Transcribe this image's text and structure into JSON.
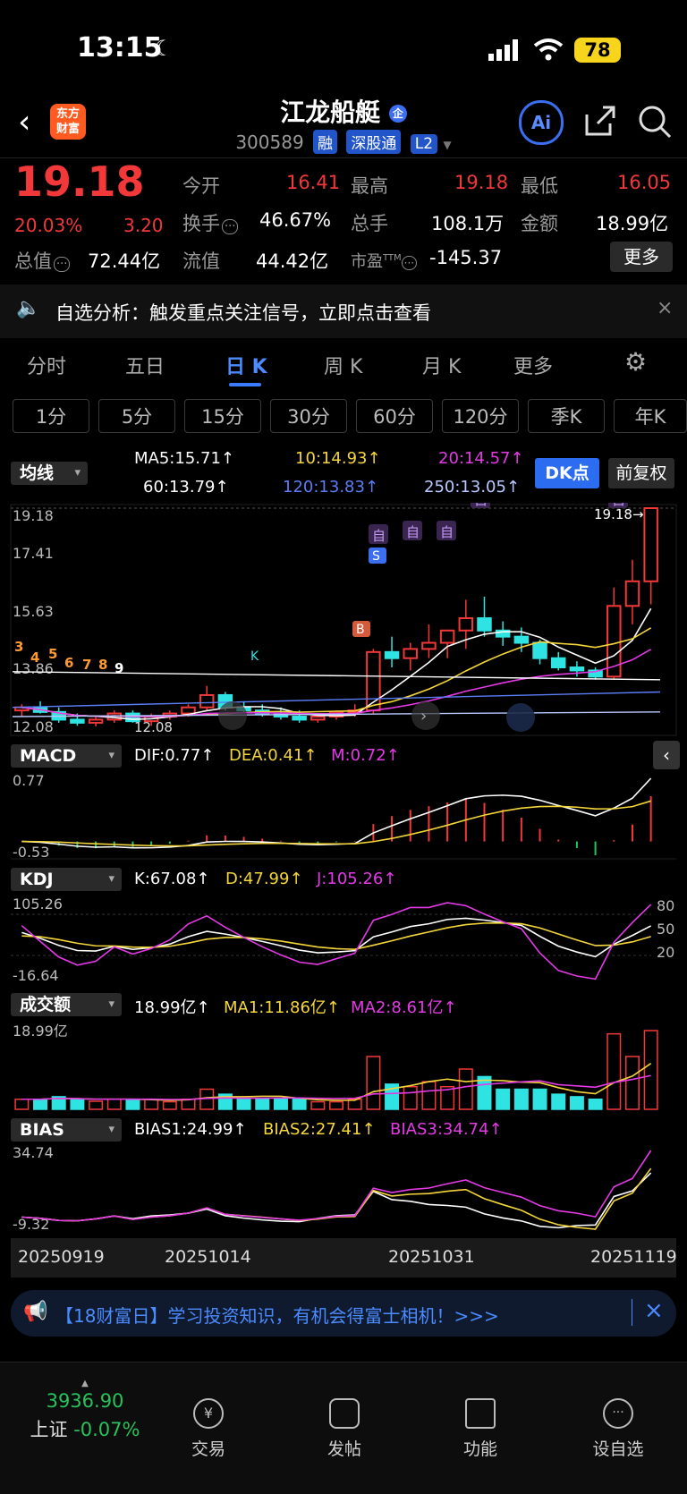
{
  "status_bar": {
    "time": "13:15",
    "battery": "78"
  },
  "header": {
    "logo_text_1": "东方",
    "logo_text_2": "财富",
    "stock_name": "江龙船艇",
    "code": "300589",
    "tags": [
      "融",
      "深股通",
      "L2"
    ]
  },
  "quote": {
    "price": "19.18",
    "change_pct": "20.03%",
    "change": "3.20",
    "today_open_label": "今开",
    "today_open": "16.41",
    "high_label": "最高",
    "high": "19.18",
    "low_label": "最低",
    "low": "16.05",
    "turnover_label": "换手",
    "turnover": "46.67%",
    "volume_label": "总手",
    "volume": "108.1万",
    "amount_label": "金额",
    "amount": "18.99亿",
    "mktcap_label": "总值",
    "mktcap": "72.44亿",
    "float_label": "流值",
    "float_cap": "44.42亿",
    "pe_label": "市盈",
    "pe_sup": "TTM",
    "pe": "-145.37",
    "more_button": "更多"
  },
  "notice": {
    "text": "自选分析：触发重点关注信号，立即点击查看"
  },
  "period_tabs": [
    "分时",
    "五日",
    "日 K",
    "周 K",
    "月 K",
    "更多"
  ],
  "active_tab": "日 K",
  "minute_buttons": [
    "1分",
    "5分",
    "15分",
    "30分",
    "60分",
    "120分",
    "季K",
    "年K"
  ],
  "ma": {
    "label": "均线",
    "ma5": "MA5:15.71↑",
    "ma10": "10:14.93↑",
    "ma20": "20:14.57↑",
    "ma60": "60:13.79↑",
    "ma120": "120:13.83↑",
    "ma250": "250:13.05↑",
    "dk_button": "DK点",
    "fuquan_button": "前复权"
  },
  "colors": {
    "red": "#f23838",
    "cyan": "#2fe3e3",
    "white": "#ffffff",
    "yellow": "#f4d63a",
    "magenta": "#e43ae6",
    "blue": "#5b7df6"
  },
  "kline_axis": {
    "y_top": "19.18",
    "y2": "17.41",
    "y3": "15.63",
    "y4": "13.86",
    "y_bottom": "12.08",
    "last_label": "19.18→",
    "low_label": "12.08",
    "marker_self": "自",
    "marker_s": "S",
    "marker_b": "B",
    "marker_k": "K",
    "seq": [
      "3",
      "4",
      "5",
      "6",
      "7",
      "8",
      "9"
    ]
  },
  "macd": {
    "label": "MACD",
    "dif": "DIF:0.77↑",
    "dea": "DEA:0.41↑",
    "m": "M:0.72↑",
    "y_top": "0.77",
    "y_bottom": "-0.53"
  },
  "kdj": {
    "label": "KDJ",
    "k": "K:67.08↑",
    "d": "D:47.99↑",
    "j": "J:105.26↑",
    "y_top": "105.26",
    "y_bottom": "-16.64",
    "r80": "80",
    "r50": "50",
    "r20": "20"
  },
  "volume": {
    "label": "成交额",
    "v": "18.99亿↑",
    "ma1": "MA1:11.86亿↑",
    "ma2": "MA2:8.61亿↑",
    "y_top": "18.99亿"
  },
  "bias": {
    "label": "BIAS",
    "b1": "BIAS1:24.99↑",
    "b2": "BIAS2:27.41↑",
    "b3": "BIAS3:34.74↑",
    "y_top": "34.74",
    "y_bottom": "-9.32"
  },
  "dates": [
    "20250919",
    "20251014",
    "20251031",
    "20251119"
  ],
  "promo": {
    "text": "【18财富日】学习投资知识，有机会得富士相机！>>>"
  },
  "bottom_nav": {
    "index_value": "3936.90",
    "index_name": "上证",
    "index_change": "-0.07%",
    "items": [
      "交易",
      "发帖",
      "功能",
      "设自选"
    ]
  },
  "chart_data": {
    "type": "candlestick",
    "title": "",
    "ylim": [
      12.08,
      19.18
    ],
    "candles": [
      [
        12.6,
        12.8,
        12.4,
        12.7
      ],
      [
        12.7,
        12.9,
        12.5,
        12.55
      ],
      [
        12.55,
        12.7,
        12.2,
        12.3
      ],
      [
        12.3,
        12.5,
        12.1,
        12.2
      ],
      [
        12.2,
        12.4,
        12.08,
        12.3
      ],
      [
        12.3,
        12.6,
        12.2,
        12.5
      ],
      [
        12.5,
        12.6,
        12.2,
        12.25
      ],
      [
        12.25,
        12.5,
        12.1,
        12.4
      ],
      [
        12.4,
        12.6,
        12.3,
        12.5
      ],
      [
        12.5,
        12.8,
        12.4,
        12.7
      ],
      [
        12.7,
        13.4,
        12.6,
        13.1
      ],
      [
        13.1,
        13.2,
        12.6,
        12.7
      ],
      [
        12.7,
        12.9,
        12.5,
        12.6
      ],
      [
        12.6,
        12.8,
        12.4,
        12.5
      ],
      [
        12.5,
        12.7,
        12.3,
        12.4
      ],
      [
        12.4,
        12.6,
        12.2,
        12.3
      ],
      [
        12.3,
        12.5,
        12.2,
        12.4
      ],
      [
        12.4,
        12.6,
        12.3,
        12.55
      ],
      [
        12.55,
        12.8,
        12.4,
        12.6
      ],
      [
        12.6,
        14.6,
        12.5,
        14.5
      ],
      [
        14.5,
        15.0,
        14.0,
        14.3
      ],
      [
        14.3,
        14.8,
        13.9,
        14.6
      ],
      [
        14.6,
        15.4,
        14.3,
        14.8
      ],
      [
        14.8,
        15.2,
        14.3,
        15.2
      ],
      [
        15.2,
        16.2,
        14.6,
        15.6
      ],
      [
        15.6,
        16.3,
        15.0,
        15.2
      ],
      [
        15.2,
        15.5,
        14.7,
        15.0
      ],
      [
        15.0,
        15.3,
        14.5,
        14.8
      ],
      [
        14.8,
        14.9,
        14.1,
        14.3
      ],
      [
        14.3,
        14.5,
        13.9,
        14.0
      ],
      [
        14.0,
        14.2,
        13.7,
        13.9
      ],
      [
        13.9,
        14.0,
        13.6,
        13.7
      ],
      [
        13.7,
        16.6,
        13.6,
        16.0
      ],
      [
        16.0,
        17.5,
        15.4,
        16.8
      ],
      [
        16.8,
        19.18,
        16.05,
        19.18
      ]
    ]
  }
}
